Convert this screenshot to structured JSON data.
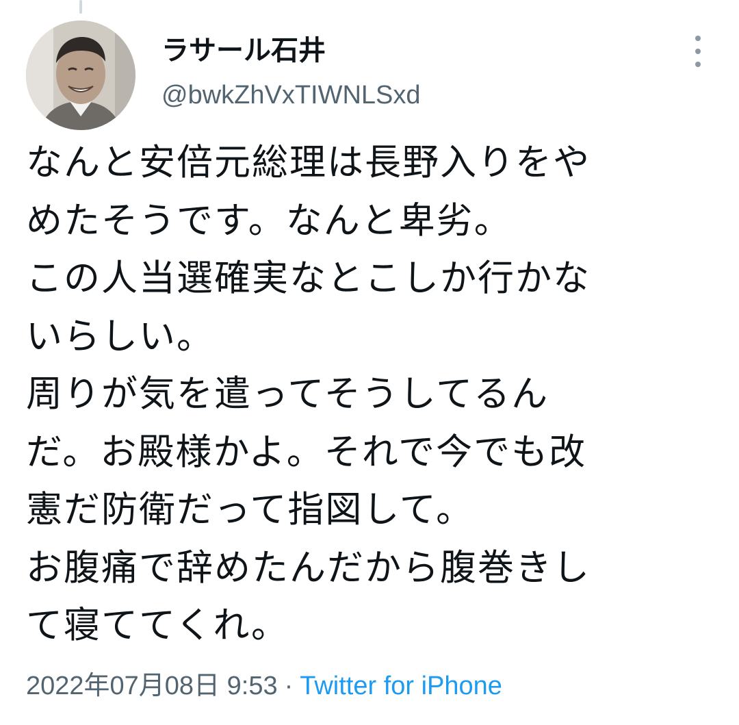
{
  "tweet": {
    "author": {
      "display_name": "ラサール石井",
      "handle": "@bwkZhVxTIWNLSxd",
      "avatar_icon": "profile-photo"
    },
    "more_icon": "more-vertical-icon",
    "text_lines": [
      "なんと安倍元総理は長野入りをや",
      "めたそうです。なんと卑劣。",
      "この人当選確実なとこしか行かな",
      "いらしい。",
      "周りが気を遣ってそうしてるん",
      "だ。お殿様かよ。それで今でも改",
      "憲だ防衛だって指図して。",
      "お腹痛で辞めたんだから腹巻きし",
      "て寝ててくれ。"
    ],
    "timestamp": "2022年07月08日 9:53",
    "separator": "·",
    "source": "Twitter for iPhone"
  },
  "colors": {
    "text": "#0f1419",
    "secondary": "#536471",
    "link": "#1d9bf0",
    "background": "#ffffff"
  }
}
